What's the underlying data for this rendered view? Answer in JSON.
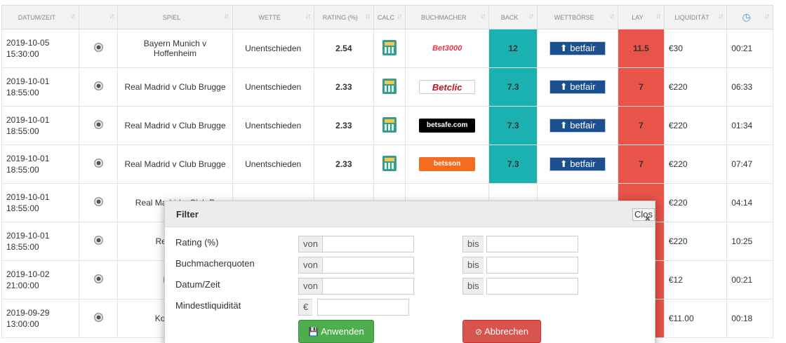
{
  "table": {
    "headers": [
      "DATUM/ZEIT",
      "",
      "SPIEL",
      "WETTE",
      "RATING (%)",
      "CALC",
      "BUCHMACHER",
      "BACK",
      "WETTBÖRSE",
      "LAY",
      "LIQUIDITÄT",
      ""
    ],
    "sort_icon": "sort-icon",
    "clock_icon": "clock-icon",
    "rows": [
      {
        "date": "2019-10-05",
        "time": "15:30:00",
        "match": "Bayern Munich v Hoffenheim",
        "bet": "Unentschieden",
        "rating": "2.54",
        "bookmaker": "Bet3000",
        "back": "12",
        "exchange": "betfair",
        "lay": "11.5",
        "liquidity": "€30",
        "age": "00:21"
      },
      {
        "date": "2019-10-01",
        "time": "18:55:00",
        "match": "Real Madrid v Club Brugge",
        "bet": "Unentschieden",
        "rating": "2.33",
        "bookmaker": "Betclic",
        "back": "7.3",
        "exchange": "betfair",
        "lay": "7",
        "liquidity": "€220",
        "age": "06:33"
      },
      {
        "date": "2019-10-01",
        "time": "18:55:00",
        "match": "Real Madrid v Club Brugge",
        "bet": "Unentschieden",
        "rating": "2.33",
        "bookmaker": "betsafe.com",
        "back": "7.3",
        "exchange": "betfair",
        "lay": "7",
        "liquidity": "€220",
        "age": "01:34"
      },
      {
        "date": "2019-10-01",
        "time": "18:55:00",
        "match": "Real Madrid v Club Brugge",
        "bet": "Unentschieden",
        "rating": "2.33",
        "bookmaker": "betsson",
        "back": "7.3",
        "exchange": "betfair",
        "lay": "7",
        "liquidity": "€220",
        "age": "07:47"
      },
      {
        "date": "2019-10-01",
        "time": "18:55:00",
        "match": "Real Madrid v Club B",
        "bet": "",
        "rating": "",
        "bookmaker": "",
        "back": "",
        "exchange": "",
        "lay": "",
        "liquidity": "€220",
        "age": "04:14"
      },
      {
        "date": "2019-10-01",
        "time": "18:55:00",
        "match": "Real Ma B",
        "bet": "",
        "rating": "",
        "bookmaker": "",
        "back": "",
        "exchange": "",
        "lay": "",
        "liquidity": "€220",
        "age": "10:25"
      },
      {
        "date": "2019-10-02",
        "time": "21:00:00",
        "match": "Barcel",
        "bet": "",
        "rating": "",
        "bookmaker": "",
        "back": "",
        "exchange": "",
        "lay": "",
        "liquidity": "€12",
        "age": "00:21"
      },
      {
        "date": "2019-09-29",
        "time": "13:00:00",
        "match": "Konyaspor",
        "bet": "",
        "rating": "",
        "bookmaker": "",
        "back": "",
        "exchange": "",
        "lay": "",
        "liquidity": "€11.00",
        "age": "00:18"
      }
    ]
  },
  "modal": {
    "title": "Filter",
    "close_label": "Clos",
    "rating_label": "Rating (%)",
    "odds_label": "Buchmacherquoten",
    "date_label": "Datum/Zeit",
    "min_liquidity_label": "Mindestliquidität",
    "from_label": "von",
    "to_label": "bis",
    "currency_symbol": "€",
    "rating_from_value": "",
    "rating_to_value": "",
    "odds_from_value": "",
    "odds_to_value": "",
    "date_from_value": "",
    "date_to_value": "",
    "min_liquidity_value": "",
    "apply_label": "Anwenden",
    "cancel_label": "Abbrechen"
  },
  "colors": {
    "back": "#1cb1b1",
    "lay": "#e8534a",
    "apply": "#4cae4c",
    "cancel": "#d9534f",
    "betfair": "#1b4f8f"
  }
}
